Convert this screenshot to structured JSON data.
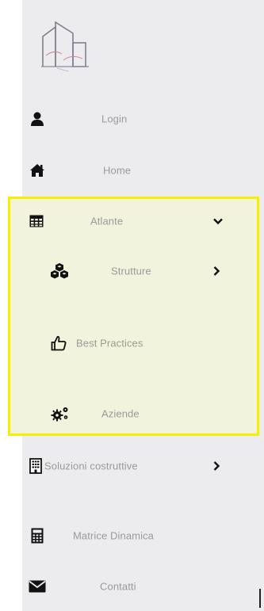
{
  "nav": {
    "login": {
      "label": "Login",
      "icon": "user-icon"
    },
    "home": {
      "label": "Home",
      "icon": "home-icon"
    },
    "atlante": {
      "label": "Atlante",
      "icon": "table-grid-icon",
      "expanded": true
    },
    "strutture": {
      "label": "Strutture",
      "icon": "cubes-icon"
    },
    "best_practices": {
      "label": "Best Practices",
      "icon": "thumbs-up-icon"
    },
    "aziende": {
      "label": "Aziende",
      "icon": "gears-icon"
    },
    "soluzioni": {
      "label": "Soluzioni costruttive",
      "icon": "building-icon"
    },
    "matrice": {
      "label": "Matrice Dinamica",
      "icon": "calculator-icon"
    },
    "contatti": {
      "label": "Contatti",
      "icon": "envelope-icon"
    }
  },
  "colors": {
    "sidebar_bg": "#ececee",
    "highlight_bg": "#f2f3dc",
    "highlight_border": "#f4f000",
    "label_text": "#9a9a9a",
    "icon": "#111111"
  }
}
